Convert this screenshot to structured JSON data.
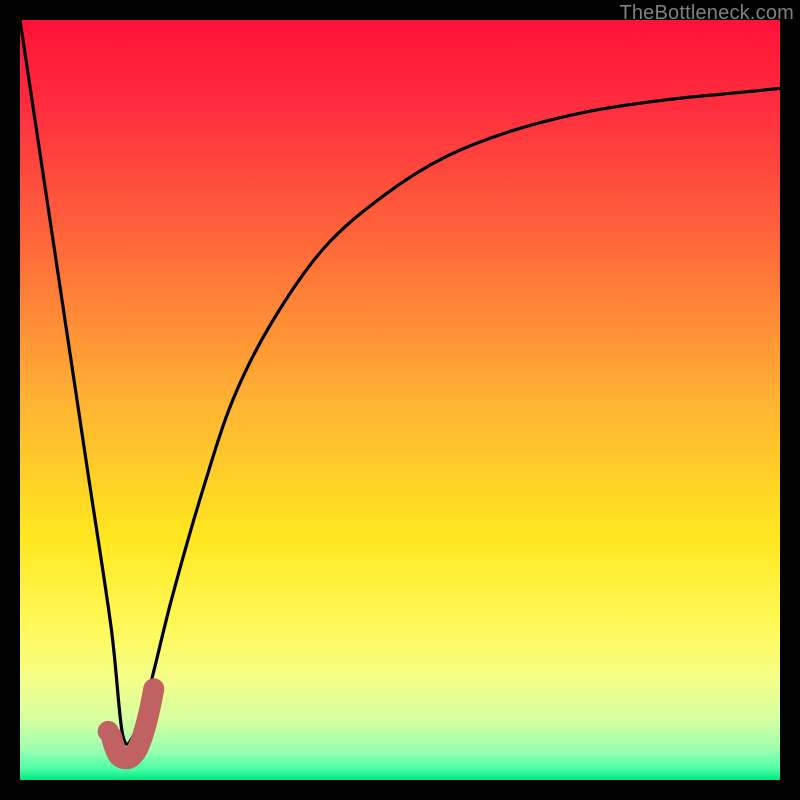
{
  "watermark": "TheBottleneck.com",
  "chart_data": {
    "type": "line",
    "title": "",
    "xlabel": "",
    "ylabel": "",
    "xlim": [
      0,
      100
    ],
    "ylim": [
      0,
      100
    ],
    "series": [
      {
        "name": "bottleneck-curve",
        "x": [
          0,
          3,
          6,
          9,
          12,
          13.5,
          15,
          17,
          20,
          24,
          28,
          33,
          40,
          48,
          56,
          65,
          75,
          85,
          95,
          100
        ],
        "y": [
          100,
          80,
          60,
          40,
          20,
          6,
          6,
          12,
          24,
          38,
          50,
          60,
          70,
          77,
          82,
          85.5,
          88,
          89.5,
          90.5,
          91
        ],
        "color": "#000000",
        "note": "V-shaped curve: steep linear fall to minimum near x≈14, then asymptotic rise toward ~91%"
      },
      {
        "name": "highlight-hook",
        "x": [
          12.0,
          12.5,
          13.0,
          13.8,
          14.6,
          15.4,
          16.2,
          17.0,
          17.6
        ],
        "y": [
          5.8,
          4.2,
          3.2,
          2.8,
          3.0,
          4.0,
          6.0,
          9.0,
          12.0
        ],
        "color": "#c16262",
        "note": "thick short J-hook overlay at the curve minimum"
      }
    ],
    "marker": {
      "name": "highlight-dot",
      "x": 11.6,
      "y": 6.4,
      "color": "#c16262"
    },
    "background_gradient": {
      "stops": [
        {
          "offset": 0.0,
          "color": "#ff1137"
        },
        {
          "offset": 0.12,
          "color": "#ff2f3f"
        },
        {
          "offset": 0.3,
          "color": "#ff6a3a"
        },
        {
          "offset": 0.5,
          "color": "#ffb233"
        },
        {
          "offset": 0.68,
          "color": "#ffe71f"
        },
        {
          "offset": 0.8,
          "color": "#fff95a"
        },
        {
          "offset": 0.87,
          "color": "#f4ff8a"
        },
        {
          "offset": 0.92,
          "color": "#d6ffa0"
        },
        {
          "offset": 0.96,
          "color": "#9dffb0"
        },
        {
          "offset": 0.985,
          "color": "#4effa8"
        },
        {
          "offset": 1.0,
          "color": "#00e880"
        }
      ]
    }
  }
}
